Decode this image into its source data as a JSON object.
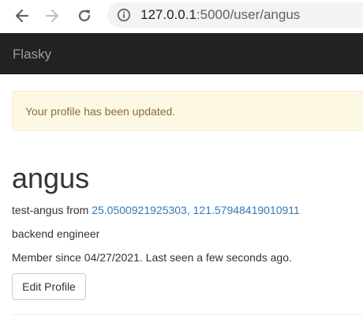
{
  "browser": {
    "url_host": "127.0.0.1",
    "url_rest": ":5000/user/angus"
  },
  "navbar": {
    "brand": "Flasky"
  },
  "alert": {
    "message": "Your profile has been updated."
  },
  "profile": {
    "username": "angus",
    "name": "test-angus",
    "from_label": "from",
    "latitude": "25.0500921925303",
    "coord_separator": ", ",
    "longitude": "121.57948419010911",
    "about": "backend engineer",
    "member_since": "Member since 04/27/2021. Last seen a few seconds ago.",
    "edit_button": "Edit Profile"
  },
  "colors": {
    "navbar_bg": "#222222",
    "alert_bg": "#fcf8e3",
    "alert_text": "#8a6d3b",
    "link": "#337ab7"
  },
  "icons": {
    "back": "arrow-left",
    "forward": "arrow-right",
    "reload": "reload",
    "site_info": "info-circle"
  }
}
